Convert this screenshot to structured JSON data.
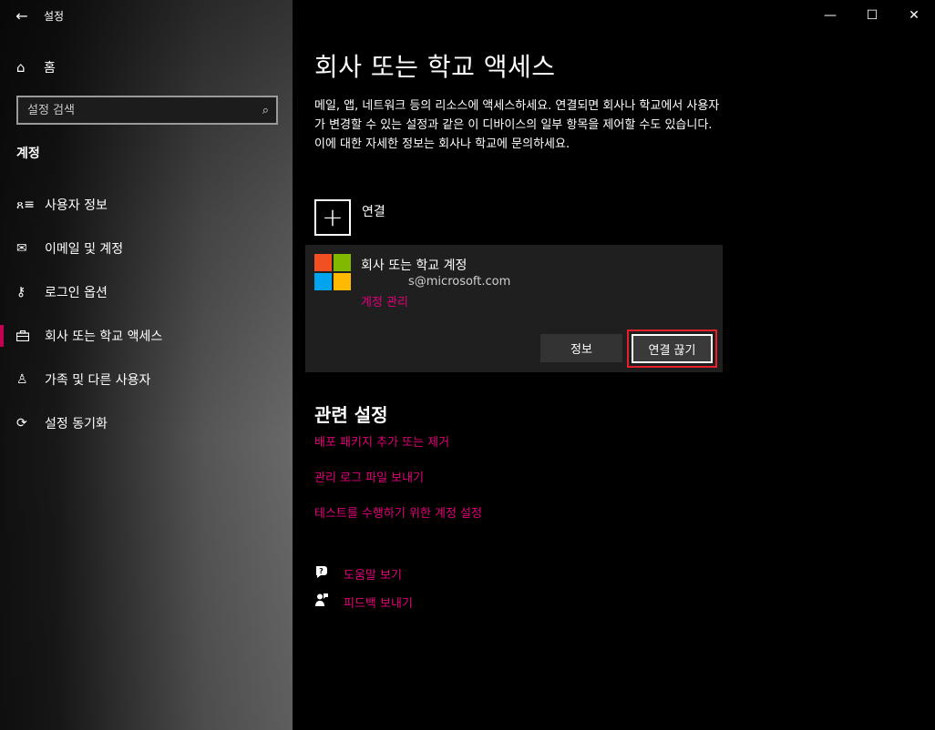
{
  "window": {
    "title": "설정",
    "back": "←",
    "controls": {
      "minimize": "—",
      "maximize": "☐",
      "close": "✕"
    }
  },
  "sidebar": {
    "home_label": "홈",
    "search": {
      "placeholder": "설정 검색"
    },
    "section_heading": "계정",
    "items": [
      {
        "label": "사용자 정보",
        "icon": "user-info-icon",
        "glyph": "ጸ≡"
      },
      {
        "label": "이메일 및 계정",
        "icon": "mail-icon",
        "glyph": "✉"
      },
      {
        "label": "로그인 옵션",
        "icon": "key-icon",
        "glyph": "⚷"
      },
      {
        "label": "회사 또는 학교 액세스",
        "icon": "briefcase-icon",
        "glyph": "💼",
        "active": true
      },
      {
        "label": "가족 및 다른 사용자",
        "icon": "add-person-icon",
        "glyph": "♙"
      },
      {
        "label": "설정 동기화",
        "icon": "sync-icon",
        "glyph": "⟳"
      }
    ]
  },
  "main": {
    "title": "회사 또는 학교 액세스",
    "description": "메일, 앱, 네트워크 등의 리소스에 액세스하세요. 연결되면 회사나 학교에서 사용자가 변경할 수 있는 설정과 같은 이 디바이스의 일부 항목을 제어할 수도 있습니다. 이에 대한 자세한 정보는 회사나 학교에 문의하세요.",
    "connect_label": "연결",
    "account": {
      "name": "회사 또는 학교 계정",
      "email": "s@microsoft.com",
      "manage_link": "계정 관리",
      "info_button": "정보",
      "disconnect_button": "연결 끊기",
      "logo_colors": [
        "#f25022",
        "#7fba00",
        "#00a4ef",
        "#ffb900"
      ]
    },
    "related": {
      "title": "관련 설정",
      "links": [
        "배포 패키지 추가 또는 제거",
        "관리 로그 파일 보내기",
        "테스트를 수행하기 위한 계정 설정"
      ]
    },
    "help": {
      "get_help": "도움말 보기",
      "feedback": "피드백 보내기"
    }
  },
  "colors": {
    "accent": "#e3007b",
    "highlight_border": "#e5202a"
  }
}
